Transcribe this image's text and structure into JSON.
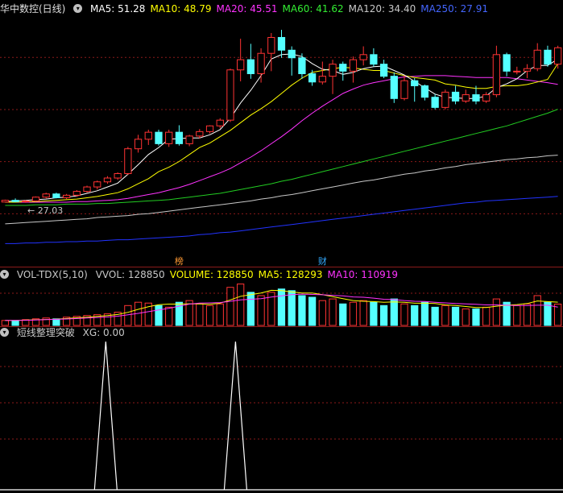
{
  "main_panel": {
    "title": "华中数控(日线)",
    "ma_values": [
      {
        "label": "MA5: 51.28",
        "color": "#ffffff"
      },
      {
        "label": "MA10: 48.79",
        "color": "#ffff00"
      },
      {
        "label": "MA20: 45.51",
        "color": "#ff33ff"
      },
      {
        "label": "MA60: 41.62",
        "color": "#33ee33"
      },
      {
        "label": "MA120: 34.40",
        "color": "#c8c8c8"
      },
      {
        "label": "MA250: 27.91",
        "color": "#4466ff"
      }
    ],
    "low_marker": "← 27.03",
    "badges": [
      {
        "text": "榜",
        "color": "#ff9933",
        "index": 17
      },
      {
        "text": "财",
        "color": "#33aaff",
        "index": 31
      }
    ]
  },
  "volume_panel": {
    "title": "VOL-TDX(5,10)",
    "values": [
      {
        "label": "VVOL: 128850",
        "color": "#c8c8c8"
      },
      {
        "label": "VOLUME: 128850",
        "color": "#ffff00"
      },
      {
        "label": "MA5: 128293",
        "color": "#ffff00"
      },
      {
        "label": "MA10: 110919",
        "color": "#ff33ff"
      }
    ]
  },
  "indicator_panel": {
    "title": "短线整理突破",
    "values": [
      {
        "label": "XG: 0.00",
        "color": "#c8c8c8"
      }
    ]
  },
  "colors": {
    "up": "#ff3333",
    "down": "#54ffff",
    "grid": "#8b1a1a",
    "separator": "#8b1a1a"
  },
  "chart_data": {
    "type": "candlestick",
    "ohlc": [
      [
        27.03,
        27.4,
        27.0,
        27.3
      ],
      [
        27.3,
        27.6,
        27.0,
        27.1
      ],
      [
        27.1,
        27.3,
        26.9,
        27.2
      ],
      [
        27.2,
        27.9,
        27.1,
        27.8
      ],
      [
        27.8,
        28.5,
        27.6,
        28.3
      ],
      [
        28.3,
        28.5,
        27.6,
        27.7
      ],
      [
        27.7,
        28.3,
        27.5,
        28.1
      ],
      [
        28.1,
        28.9,
        27.9,
        28.7
      ],
      [
        28.7,
        29.6,
        28.5,
        29.4
      ],
      [
        29.4,
        30.4,
        29.0,
        30.2
      ],
      [
        30.2,
        31.1,
        29.9,
        30.8
      ],
      [
        30.8,
        31.7,
        30.5,
        31.5
      ],
      [
        31.5,
        35.7,
        31.3,
        35.4
      ],
      [
        35.4,
        37.6,
        34.8,
        36.9
      ],
      [
        36.9,
        38.4,
        36.0,
        38.0
      ],
      [
        38.0,
        38.4,
        35.9,
        36.2
      ],
      [
        36.2,
        38.4,
        35.7,
        38.0
      ],
      [
        38.0,
        39.1,
        35.9,
        36.2
      ],
      [
        36.2,
        37.6,
        35.8,
        37.4
      ],
      [
        37.4,
        38.5,
        37.0,
        38.1
      ],
      [
        38.1,
        39.1,
        37.8,
        39.0
      ],
      [
        39.0,
        40.2,
        38.6,
        39.9
      ],
      [
        39.9,
        48.0,
        39.6,
        47.8
      ],
      [
        47.8,
        52.7,
        46.0,
        49.4
      ],
      [
        49.4,
        51.9,
        46.4,
        47.2
      ],
      [
        47.2,
        51.2,
        45.8,
        50.4
      ],
      [
        50.4,
        53.6,
        47.6,
        52.9
      ],
      [
        52.9,
        54.1,
        49.7,
        50.9
      ],
      [
        50.9,
        51.5,
        46.9,
        49.7
      ],
      [
        49.7,
        50.4,
        46.4,
        47.2
      ],
      [
        47.2,
        47.8,
        45.3,
        45.9
      ],
      [
        45.9,
        49.1,
        45.5,
        46.8
      ],
      [
        46.8,
        49.4,
        44.0,
        48.7
      ],
      [
        48.7,
        49.1,
        46.1,
        47.6
      ],
      [
        47.6,
        49.9,
        45.8,
        49.4
      ],
      [
        49.4,
        51.5,
        48.5,
        50.2
      ],
      [
        50.2,
        51.2,
        48.3,
        48.7
      ],
      [
        48.7,
        49.4,
        46.5,
        46.8
      ],
      [
        46.8,
        47.4,
        42.6,
        43.3
      ],
      [
        43.3,
        46.9,
        43.0,
        46.1
      ],
      [
        46.1,
        46.5,
        42.8,
        45.3
      ],
      [
        45.3,
        45.5,
        43.0,
        43.5
      ],
      [
        43.5,
        44.0,
        41.6,
        41.9
      ],
      [
        41.9,
        44.7,
        41.6,
        44.3
      ],
      [
        44.3,
        45.3,
        42.4,
        42.9
      ],
      [
        42.9,
        44.7,
        42.6,
        43.9
      ],
      [
        43.9,
        45.3,
        42.4,
        42.9
      ],
      [
        42.9,
        44.3,
        42.6,
        43.9
      ],
      [
        43.9,
        51.6,
        43.5,
        50.2
      ],
      [
        50.2,
        50.5,
        46.8,
        47.6
      ],
      [
        47.6,
        48.3,
        47.1,
        47.6
      ],
      [
        47.6,
        48.7,
        46.5,
        48.0
      ],
      [
        48.0,
        52.0,
        47.6,
        50.9
      ],
      [
        50.9,
        51.6,
        48.3,
        48.7
      ],
      [
        48.7,
        51.6,
        48.0,
        51.28
      ]
    ],
    "ma5": [
      27.1,
      27.2,
      27.3,
      27.4,
      27.5,
      27.7,
      27.8,
      28.0,
      28.4,
      28.8,
      29.4,
      30.0,
      31.4,
      32.9,
      34.5,
      35.6,
      36.9,
      37.0,
      37.1,
      37.1,
      37.6,
      38.4,
      40.2,
      42.6,
      44.6,
      46.9,
      49.5,
      50.2,
      50.3,
      49.9,
      48.8,
      47.9,
      47.7,
      47.1,
      47.4,
      48.0,
      48.3,
      48.4,
      47.7,
      47.0,
      46.0,
      45.0,
      44.0,
      43.5,
      43.4,
      43.3,
      43.3,
      43.7,
      45.0,
      45.6,
      46.4,
      47.7,
      48.5,
      48.5,
      49.5
    ],
    "ma10": [
      27.0,
      27.0,
      27.1,
      27.1,
      27.2,
      27.3,
      27.4,
      27.5,
      27.7,
      27.9,
      28.2,
      28.5,
      29.1,
      29.9,
      30.7,
      31.8,
      32.5,
      33.4,
      34.5,
      35.6,
      36.3,
      37.3,
      38.3,
      39.5,
      40.7,
      41.7,
      42.8,
      44.1,
      45.4,
      46.5,
      47.4,
      47.7,
      48.0,
      48.2,
      48.1,
      47.9,
      47.7,
      47.7,
      47.3,
      46.9,
      46.6,
      46.4,
      46.2,
      45.6,
      45.4,
      45.1,
      44.9,
      44.9,
      45.2,
      45.3,
      45.3,
      45.5,
      45.9,
      46.3,
      48.79
    ],
    "ma20": [
      27.0,
      27.0,
      27.0,
      27.0,
      27.0,
      27.0,
      27.0,
      27.1,
      27.1,
      27.2,
      27.3,
      27.4,
      27.6,
      27.9,
      28.2,
      28.5,
      28.9,
      29.3,
      29.8,
      30.4,
      31.0,
      31.6,
      32.3,
      33.2,
      34.1,
      35.1,
      36.2,
      37.3,
      38.5,
      39.8,
      41.0,
      42.1,
      43.1,
      44.1,
      44.8,
      45.4,
      45.8,
      46.1,
      46.4,
      46.7,
      46.8,
      46.9,
      46.9,
      46.9,
      46.8,
      46.7,
      46.6,
      46.6,
      46.6,
      46.6,
      46.4,
      46.2,
      46.0,
      45.8,
      45.51
    ],
    "ma60": [
      26.5,
      26.5,
      26.5,
      26.6,
      26.6,
      26.6,
      26.7,
      26.7,
      26.7,
      26.8,
      26.8,
      26.9,
      27.0,
      27.1,
      27.2,
      27.3,
      27.4,
      27.6,
      27.8,
      28.0,
      28.2,
      28.4,
      28.7,
      29.0,
      29.3,
      29.6,
      29.9,
      30.3,
      30.6,
      31.0,
      31.4,
      31.8,
      32.2,
      32.6,
      33.0,
      33.4,
      33.8,
      34.2,
      34.6,
      35.0,
      35.4,
      35.8,
      36.2,
      36.6,
      37.0,
      37.4,
      37.8,
      38.2,
      38.6,
      39.0,
      39.5,
      40.0,
      40.5,
      41.0,
      41.62
    ],
    "ma120": [
      23.6,
      23.7,
      23.8,
      23.9,
      24.0,
      24.1,
      24.2,
      24.3,
      24.4,
      24.6,
      24.7,
      24.8,
      24.9,
      25.1,
      25.2,
      25.4,
      25.6,
      25.8,
      26.0,
      26.2,
      26.4,
      26.6,
      26.8,
      27.0,
      27.2,
      27.5,
      27.7,
      28.0,
      28.2,
      28.5,
      28.8,
      29.1,
      29.4,
      29.7,
      30.0,
      30.3,
      30.5,
      30.8,
      31.1,
      31.4,
      31.6,
      31.9,
      32.1,
      32.4,
      32.6,
      32.9,
      33.1,
      33.3,
      33.5,
      33.7,
      33.8,
      34.0,
      34.1,
      34.3,
      34.4
    ],
    "ma250": [
      20.5,
      20.5,
      20.6,
      20.6,
      20.7,
      20.7,
      20.8,
      20.8,
      20.9,
      20.9,
      21.0,
      21.1,
      21.1,
      21.2,
      21.3,
      21.4,
      21.5,
      21.6,
      21.7,
      21.9,
      22.0,
      22.2,
      22.3,
      22.5,
      22.7,
      22.9,
      23.1,
      23.3,
      23.5,
      23.7,
      23.9,
      24.1,
      24.3,
      24.5,
      24.7,
      24.9,
      25.1,
      25.3,
      25.5,
      25.7,
      25.9,
      26.1,
      26.3,
      26.5,
      26.7,
      26.9,
      27.0,
      27.2,
      27.3,
      27.4,
      27.5,
      27.6,
      27.7,
      27.8,
      27.91
    ],
    "volume": [
      30,
      30,
      35,
      40,
      45,
      40,
      50,
      55,
      60,
      65,
      70,
      80,
      120,
      140,
      135,
      120,
      110,
      140,
      150,
      130,
      120,
      130,
      230,
      250,
      200,
      180,
      200,
      220,
      210,
      180,
      170,
      150,
      160,
      130,
      140,
      150,
      140,
      120,
      160,
      130,
      120,
      140,
      110,
      120,
      110,
      100,
      100,
      110,
      160,
      140,
      120,
      130,
      180,
      140,
      128.85
    ],
    "vol_ma5": [
      30,
      30,
      32,
      34,
      36,
      38,
      42,
      46,
      50,
      55,
      60,
      66,
      79,
      97,
      113,
      125,
      129,
      129,
      131,
      130,
      128,
      134,
      154,
      176,
      186,
      196,
      212,
      210,
      202,
      196,
      196,
      186,
      174,
      162,
      150,
      146,
      144,
      140,
      142,
      140,
      134,
      134,
      132,
      124,
      120,
      114,
      108,
      108,
      116,
      122,
      126,
      132,
      148,
      144,
      140.5
    ],
    "vol_ma10": [
      30,
      30,
      31,
      33,
      35,
      37,
      39,
      42,
      45,
      48,
      51,
      56,
      64,
      73,
      83,
      94,
      103,
      116,
      129,
      135,
      136,
      138,
      146,
      154,
      158,
      162,
      171,
      179,
      186,
      189,
      187,
      185,
      182,
      179,
      172,
      170,
      165,
      158,
      156,
      150,
      146,
      145,
      140,
      136,
      132,
      130,
      128,
      124,
      124,
      122,
      120,
      120,
      122,
      122,
      110.9
    ],
    "xg": [
      0,
      0,
      0,
      0,
      0,
      0,
      0,
      0,
      0,
      0,
      0,
      1,
      0,
      0,
      0,
      0,
      0,
      0,
      0,
      0,
      0,
      0,
      0,
      0,
      0,
      0,
      0,
      0,
      0,
      0,
      0,
      0,
      0,
      0,
      0,
      0,
      0,
      0,
      0,
      0,
      0,
      0,
      0,
      0,
      0,
      0,
      0,
      0,
      0,
      0,
      0,
      0,
      0,
      0,
      0
    ],
    "xg_spikes": [
      {
        "index": 7,
        "value": 1
      },
      {
        "index": 17,
        "value": 1
      }
    ]
  }
}
